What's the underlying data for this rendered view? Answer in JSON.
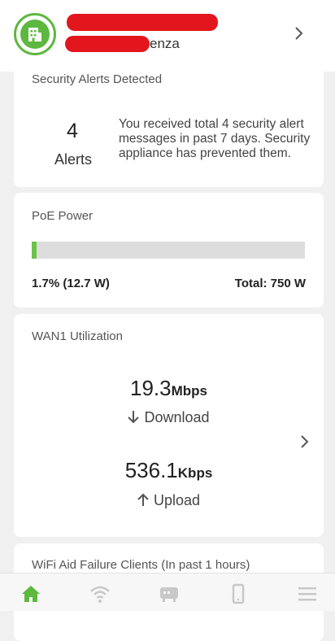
{
  "header": {
    "site_name_visible": "enza"
  },
  "security": {
    "title": "Security Alerts Detected",
    "count": "4",
    "count_label": "Alerts",
    "message": "You received total 4 security alert messages in past 7 days. Security appliance has prevented them."
  },
  "poe": {
    "title": "PoE Power",
    "used": "1.7% (12.7 W)",
    "total": "Total: 750 W",
    "fraction_used": 0.017
  },
  "wan": {
    "title": "WAN1 Utilization",
    "download_value": "19.3",
    "download_unit": "Mbps",
    "download_label": "Download",
    "upload_value": "536.1",
    "upload_unit": "Kbps",
    "upload_label": "Upload"
  },
  "wifi": {
    "title": "WiFi Aid Failure Clients (In past 1 hours)"
  },
  "nav": {
    "items": [
      "home-icon",
      "wifi-icon",
      "device-icon",
      "mobile-icon",
      "menu-icon"
    ],
    "active": "home-icon"
  },
  "colors": {
    "accent": "#5cb83e",
    "redaction": "#e3151d",
    "inactive_icon": "#c8c8c8"
  }
}
